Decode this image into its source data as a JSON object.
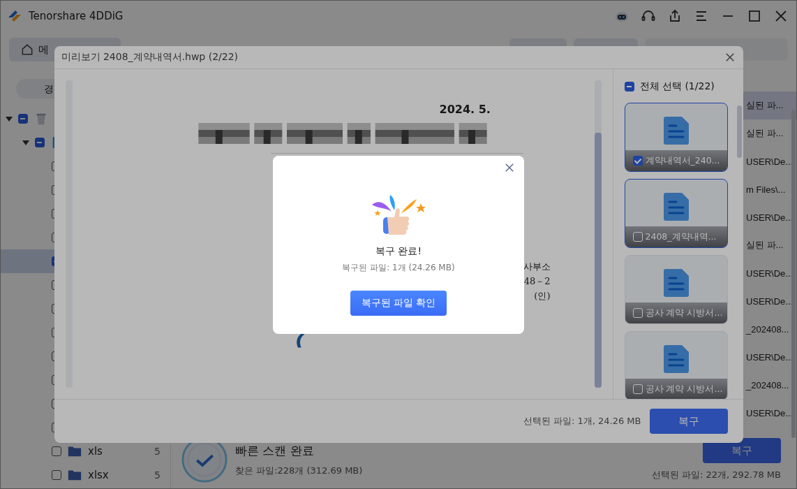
{
  "app": {
    "title": "Tenorshare 4DDiG",
    "home_tab": "메"
  },
  "sidebar": {
    "path_chip": "경",
    "tree": [
      {
        "expanded": true,
        "indeterminate": true,
        "selected": false,
        "children": [
          {
            "expanded": true,
            "indeterminate": true,
            "selected": false,
            "children": [
              {
                "checked": false,
                "selected": false
              },
              {
                "checked": false,
                "selected": false
              },
              {
                "checked": false,
                "selected": false
              },
              {
                "checked": false,
                "selected": false
              },
              {
                "checked": true,
                "selected": true
              },
              {
                "checked": false,
                "selected": false
              },
              {
                "checked": false,
                "selected": false
              },
              {
                "checked": false,
                "selected": false
              },
              {
                "checked": false,
                "selected": false
              },
              {
                "checked": false,
                "selected": false
              },
              {
                "checked": false,
                "selected": false
              },
              {
                "checked": false,
                "selected": false
              },
              {
                "label": "xls",
                "count": "5",
                "checked": false,
                "selected": false
              },
              {
                "label": "xlsx",
                "count": "5",
                "checked": false,
                "selected": false
              }
            ]
          }
        ]
      }
    ]
  },
  "file_list": {
    "rows": [
      {
        "text": "실된 파...",
        "selected": true
      },
      {
        "text": "실된 파...",
        "selected": false
      },
      {
        "text": "USER\\De...",
        "selected": false
      },
      {
        "text": "m Files\\...",
        "selected": false
      },
      {
        "text": "USER\\De...",
        "selected": false
      },
      {
        "text": "실된 파...",
        "selected": false
      },
      {
        "text": "USER\\De...",
        "selected": false
      },
      {
        "text": "USER\\De...",
        "selected": false
      },
      {
        "text": "_202408...",
        "selected": false
      },
      {
        "text": "USER\\De...",
        "selected": false
      },
      {
        "text": "_202408...",
        "selected": false
      },
      {
        "text": "USER\\De...",
        "selected": false
      }
    ]
  },
  "scan_status": {
    "title": "빠른 스캔 완료",
    "found": "찾은 파일:228개 (312.69 MB)",
    "recover_button": "복구",
    "selected_info": "선택된 파일: 22개, 292.78 MB"
  },
  "preview": {
    "title": "미리보기 2408_계약내역서.hwp (2/22)",
    "document": {
      "date": "2024. 5.",
      "office": "사부소",
      "number": "48－2",
      "seal": "(인)"
    },
    "select_all": {
      "label": "전체 선택 (1/22)",
      "indeterminate": true
    },
    "thumbnails": [
      {
        "name": "계약내역서_240...",
        "checked": true,
        "selected": true
      },
      {
        "name": "2408_계약내역...",
        "checked": false,
        "selected": true
      },
      {
        "name": "공사 계약 시방서...",
        "checked": false,
        "selected": false
      },
      {
        "name": "공사 계약 시방서...",
        "checked": false,
        "selected": false
      }
    ],
    "selected_info": "선택된 파일: 1개, 24.26 MB",
    "recover_button": "복구"
  },
  "dialog": {
    "title": "복구 완료!",
    "message": "복구된 파일: 1개 (24.26 MB)",
    "button": "복구된 파일 확인"
  }
}
